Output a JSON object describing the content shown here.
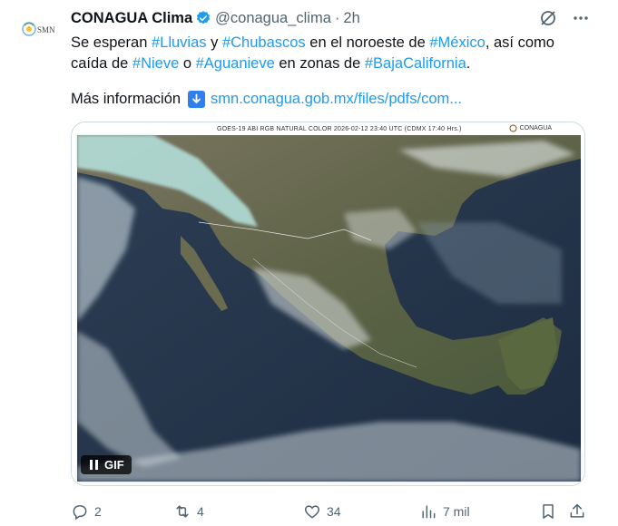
{
  "author": {
    "name": "CONAGUA Clima",
    "handle": "@conagua_clima",
    "separator": "·",
    "time": "2h",
    "avatar_text": "SMN"
  },
  "tweet": {
    "line1": [
      {
        "t": "Se esperan ",
        "tag": false
      },
      {
        "t": "#Lluvias",
        "tag": true
      },
      {
        "t": " y ",
        "tag": false
      },
      {
        "t": "#Chubascos",
        "tag": true
      },
      {
        "t": " en el noroeste de ",
        "tag": false
      },
      {
        "t": "#México",
        "tag": true
      },
      {
        "t": ", así como",
        "tag": false
      }
    ],
    "line2": [
      {
        "t": "caída de ",
        "tag": false
      },
      {
        "t": "#Nieve",
        "tag": true
      },
      {
        "t": " o ",
        "tag": false
      },
      {
        "t": "#Aguanieve",
        "tag": true
      },
      {
        "t": " en zonas de ",
        "tag": false
      },
      {
        "t": "#BajaCalifornia",
        "tag": true
      },
      {
        "t": ".",
        "tag": false
      }
    ],
    "more_label": "Más información",
    "link_text": "smn.conagua.gob.mx/files/pdfs/com..."
  },
  "media": {
    "caption": "GOES-19 ABI RGB NATURAL COLOR 2026-02-12 23:40 UTC (CDMX 17:40 Hrs.)",
    "logo_text": "CONAGUA",
    "gif_label": "GIF"
  },
  "actions": {
    "replies": "2",
    "reposts": "4",
    "likes": "34",
    "views": "7 mil"
  },
  "colors": {
    "accent": "#1d9bf0",
    "muted": "#536471",
    "text": "#0f1419"
  },
  "icons": [
    "verified-badge-icon",
    "grok-icon",
    "more-icon",
    "download-arrow-icon",
    "pause-icon",
    "reply-icon",
    "repost-icon",
    "like-icon",
    "views-icon",
    "bookmark-icon",
    "share-icon"
  ]
}
